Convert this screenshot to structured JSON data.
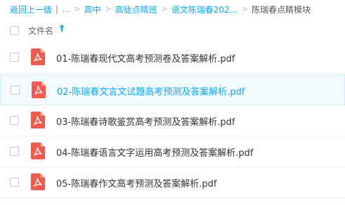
{
  "breadcrumb": {
    "back": "返回上一级",
    "divider": "|",
    "ellipsis": "...",
    "sep": ">",
    "items": [
      "高中",
      "高徒点睛班",
      "语文陈瑞春202..."
    ],
    "current": "陈瑞春点睛模块"
  },
  "list_header": {
    "name_label": "文件名",
    "sort_icon": "arrow-up-icon"
  },
  "files": [
    {
      "name": "01-陈瑞春现代文高考预测卷及答案解析.pdf",
      "icon": "pdf-icon",
      "hovered": false
    },
    {
      "name": "02-陈瑞春文言文试题高考预测及答案解析.pdf",
      "icon": "pdf-icon",
      "hovered": true
    },
    {
      "name": "03-陈瑞春诗歌鉴赏高考预测及答案解析.pdf",
      "icon": "pdf-icon",
      "hovered": false
    },
    {
      "name": "04-陈瑞春语言文字运用高考预测及答案解析.pdf",
      "icon": "pdf-icon",
      "hovered": false
    },
    {
      "name": "05-陈瑞春作文高考预测及答案解析.pdf",
      "icon": "pdf-icon",
      "hovered": false
    }
  ],
  "colors": {
    "accent": "#06a7ff",
    "pdf_red": "#f05a4f",
    "hover_bg": "#f4fbff"
  }
}
